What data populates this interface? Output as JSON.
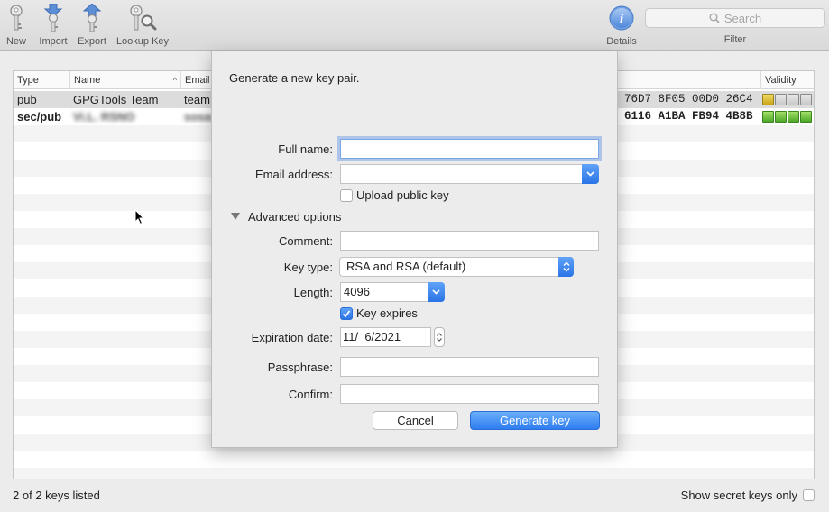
{
  "toolbar": {
    "new_label": "New",
    "import_label": "Import",
    "export_label": "Export",
    "lookup_label": "Lookup Key",
    "details_label": "Details",
    "search_placeholder": "Search",
    "filter_label": "Filter"
  },
  "table": {
    "columns": {
      "type": "Type",
      "name": "Name",
      "email": "Email",
      "validity": "Validity"
    },
    "rows": [
      {
        "type": "pub",
        "name": "GPGTools Team",
        "email": "team",
        "fingerprint": "76D7 8F05 00D0 26C4",
        "validity": "gold-1-of-4"
      },
      {
        "type": "sec/pub",
        "name": "Vi.L. RSNO",
        "email": "sosa@",
        "fingerprint": "6116 A1BA FB94 4B8B",
        "validity": "green-4-of-4"
      }
    ]
  },
  "status": {
    "count": "2 of 2 keys listed",
    "show_secret": "Show secret keys only"
  },
  "dialog": {
    "title": "Generate a new key pair.",
    "full_name_label": "Full name:",
    "full_name_value": "",
    "email_label": "Email address:",
    "email_value": "",
    "upload_label": "Upload public key",
    "upload_checked": false,
    "advanced_label": "Advanced options",
    "comment_label": "Comment:",
    "comment_value": "",
    "key_type_label": "Key type:",
    "key_type_value": "RSA and RSA (default)",
    "length_label": "Length:",
    "length_value": "4096",
    "expires_label": "Key expires",
    "expires_checked": true,
    "expiration_label": "Expiration date:",
    "expiration_value": "11/  6/2021",
    "passphrase_label": "Passphrase:",
    "confirm_label": "Confirm:",
    "cancel_label": "Cancel",
    "generate_label": "Generate key"
  },
  "colors": {
    "accent": "#2f7df0",
    "validity_gold": "#d4b21f",
    "validity_green": "#5cb833"
  }
}
